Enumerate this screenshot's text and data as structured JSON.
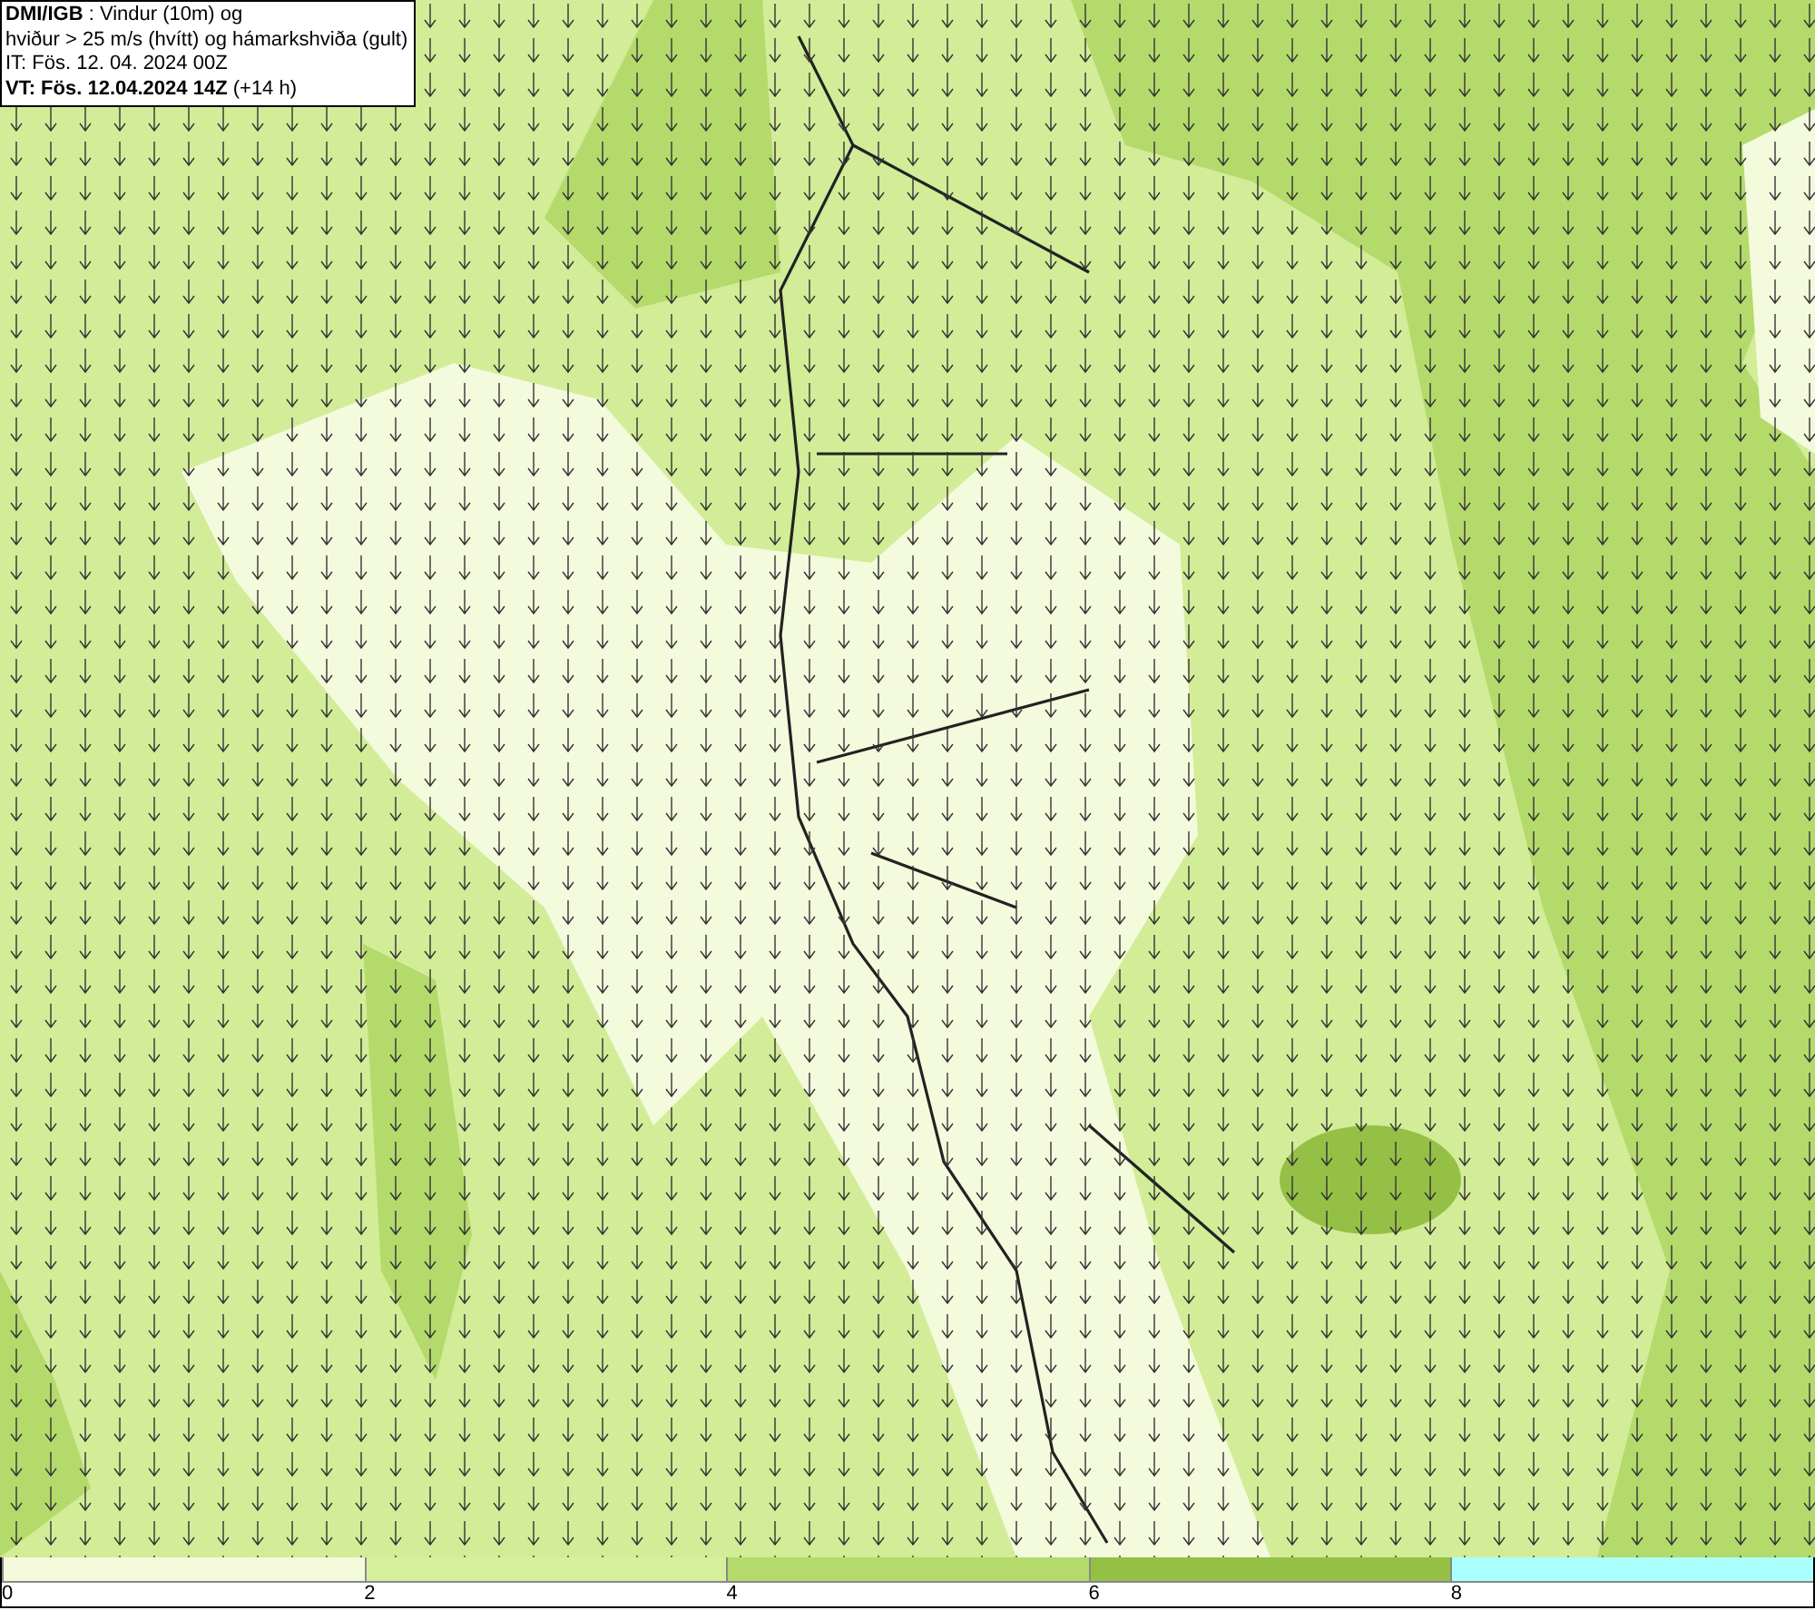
{
  "info_box": {
    "lines": [
      "**DMI/IGB** : Vindur (10m) og",
      "hviður > 25 m/s (hvítt) og hámarkshviða (gult)",
      "IT: Fös. 12. 04. 2024 00Z",
      "**VT: Fös. 12.04.2024 14Z** (+14 h)"
    ]
  },
  "legend": {
    "bins": [
      {
        "color": "#f4fadc",
        "label": "0"
      },
      {
        "color": "#d6f09c",
        "label": "2"
      },
      {
        "color": "#b4da6c",
        "label": "4"
      },
      {
        "color": "#95c046",
        "label": "6"
      },
      {
        "color": "#aaffff",
        "label": "8"
      }
    ]
  }
}
